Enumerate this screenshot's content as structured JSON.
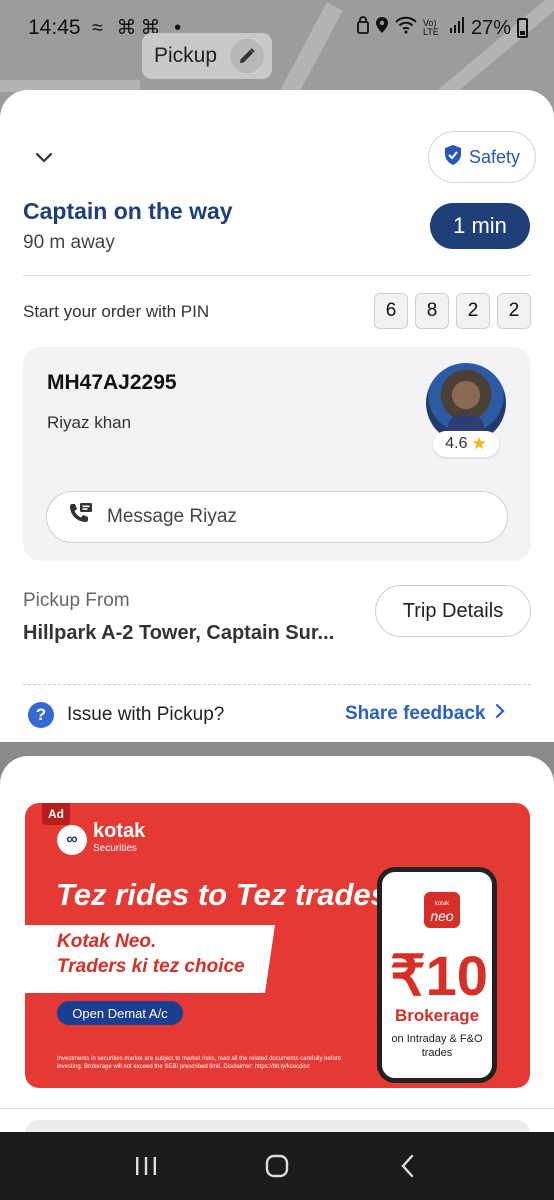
{
  "status_bar": {
    "time": "14:45",
    "notification_icons": "≈ ⌘⌘ •",
    "network": "Vo) LTE",
    "battery": "27%"
  },
  "map": {
    "pickup_chip_label": "Pickup"
  },
  "header": {
    "safety_label": "Safety"
  },
  "status": {
    "title": "Captain on the way",
    "distance": "90 m away",
    "eta": "1 min"
  },
  "pin": {
    "label": "Start your order with PIN",
    "digits": [
      "6",
      "8",
      "2",
      "2"
    ]
  },
  "driver": {
    "plate": "MH47AJ2295",
    "name": "Riyaz khan",
    "rating": "4.6",
    "message_label": "Message Riyaz"
  },
  "pickup": {
    "label": "Pickup From",
    "address": "Hillpark A-2 Tower, Captain Sur...",
    "trip_details_label": "Trip Details"
  },
  "issue": {
    "label": "Issue with Pickup?",
    "feedback_label": "Share feedback"
  },
  "ad": {
    "tag": "Ad",
    "brand": "kotak",
    "brand_sub": "Securities",
    "headline": "Tez rides to Tez trades",
    "banner_line1": "Kotak Neo.",
    "banner_line2": "Traders ki tez choice",
    "cta": "Open Demat A/c",
    "disclaimer": "Investments in securities market are subject to market risks, read all the related documents carefully before investing. Brokerage will not exceed the SEBI prescribed limit. Disclaimer: https://bit.ly/ksecdisc",
    "app_brand": "kotak",
    "app_name": "neo",
    "price": "₹10",
    "price_caption": "Brokerage",
    "price_detail": "on Intraday & F&O trades"
  },
  "colors": {
    "primary": "#1f3f78",
    "link": "#2a5fc4",
    "ad_red": "#e53a33"
  }
}
